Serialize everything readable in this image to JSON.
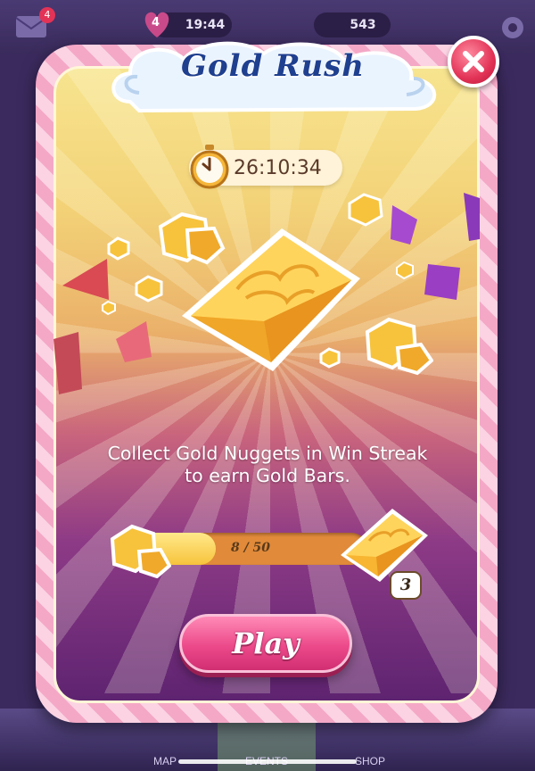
{
  "hud": {
    "mail_badge": "4",
    "lives": "4",
    "lives_timer": "19:44",
    "currency": "543"
  },
  "nav": {
    "map": "MAP",
    "events": "EVENTS",
    "shop": "SHOP"
  },
  "dialog": {
    "title": "Gold Rush",
    "timer": "26:10:34",
    "description_line1": "Collect Gold Nuggets in Win Streak",
    "description_line2": "to earn Gold Bars.",
    "progress": {
      "current": 8,
      "total": 50,
      "label": "8 / 50"
    },
    "gold_bar_count": "3",
    "play_label": "Play"
  },
  "icons": [
    "mail-icon",
    "heart-icon",
    "gear-icon",
    "close-icon",
    "stopwatch-icon",
    "gold-bar-icon",
    "gold-nugget-icon"
  ],
  "colors": {
    "title": "#1f3f8f",
    "play": "#ec4a8a",
    "frame": "#f4a8c6",
    "close": "#e23356"
  }
}
